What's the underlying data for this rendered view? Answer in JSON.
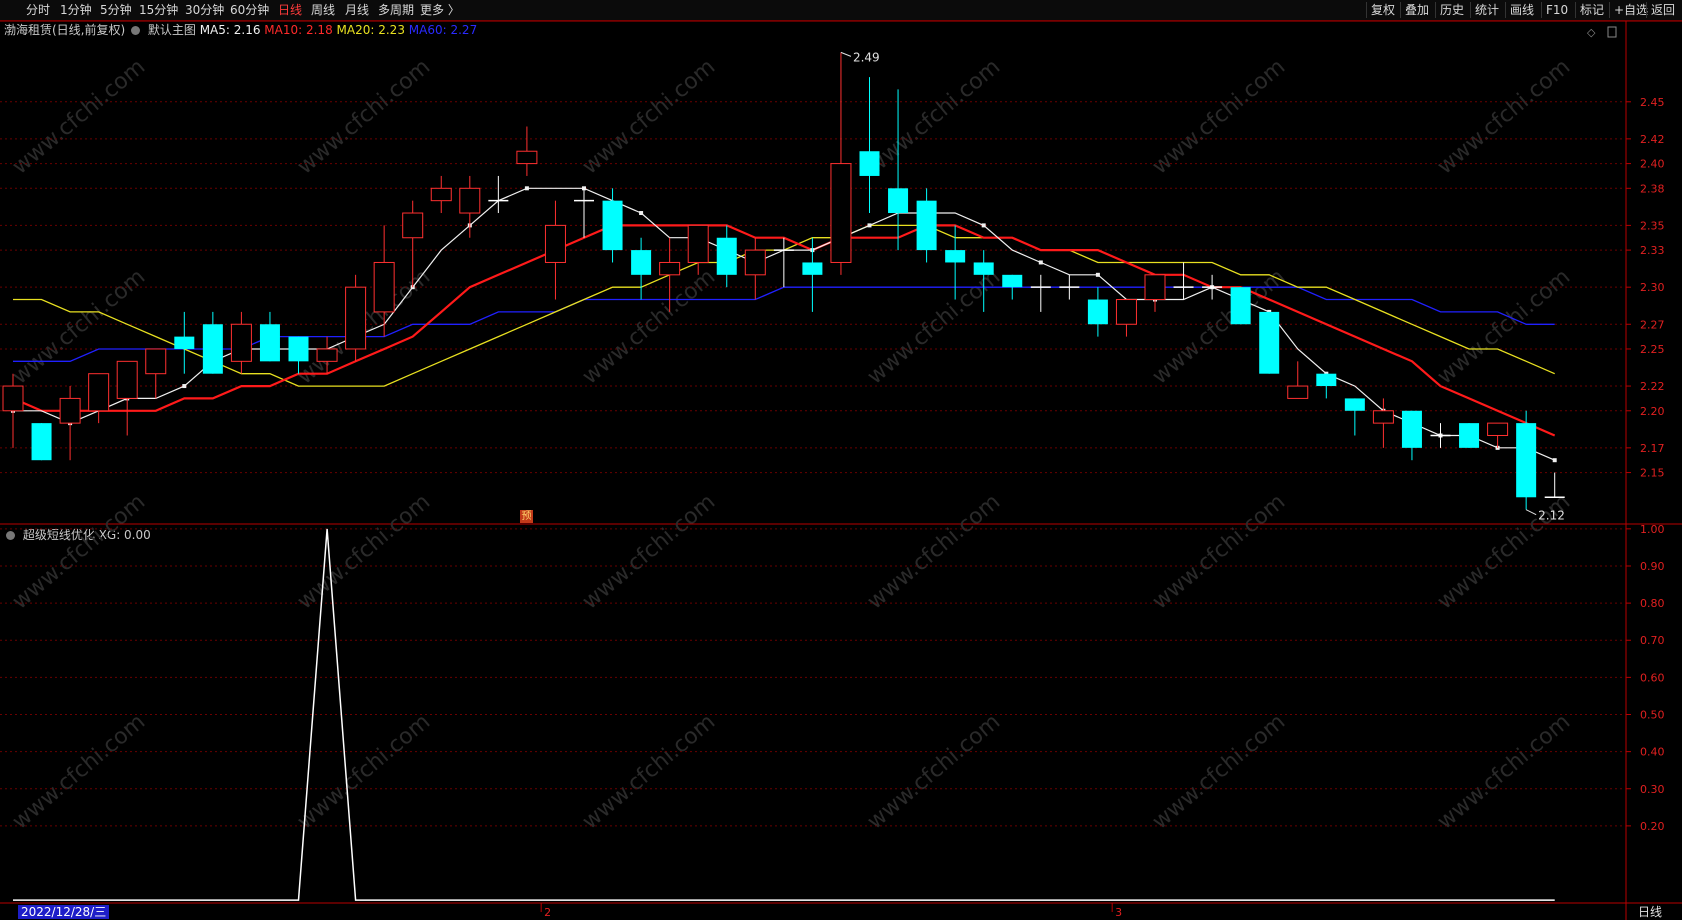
{
  "toolbar": {
    "left_items": [
      "分时",
      "1分钟",
      "5分钟",
      "15分钟",
      "30分钟",
      "60分钟",
      "日线",
      "周线",
      "月线",
      "多周期",
      "更多 〉"
    ],
    "active": "日线",
    "right_items": [
      "复权",
      "叠加",
      "历史",
      "统计",
      "画线",
      "F10",
      "标记",
      "+自选",
      "返回"
    ]
  },
  "main_panel": {
    "title": "渤海租赁(日线,前复权)",
    "template": "默认主图",
    "ma5_label": "MA5: 2.16",
    "ma10_label": "MA10: 2.18",
    "ma20_label": "MA20: 2.23",
    "ma60_label": "MA60: 2.27",
    "high_marker": "2.49",
    "low_marker": "2.12",
    "pre_badge": "预"
  },
  "indicator_panel": {
    "title": "超级短线优化",
    "value_label": "XG: 0.00"
  },
  "bottom": {
    "date_label": "2022/12/28/三",
    "month_markers": [
      "2",
      "3"
    ],
    "period_button": "日线"
  },
  "watermark": "www.cfchi.com",
  "colors": {
    "up": "#ff3030",
    "down": "#00ffff",
    "ma5": "#f0f0f0",
    "ma10": "#ff1a1a",
    "ma20": "#e8e020",
    "ma60": "#2020ff",
    "axis": "#b80000",
    "grid": "#6a0000",
    "indicator": "#ffffff"
  },
  "chart_data": [
    {
      "type": "candlestick",
      "y_ticks": [
        2.15,
        2.17,
        2.2,
        2.22,
        2.25,
        2.27,
        2.3,
        2.33,
        2.35,
        2.38,
        2.4,
        2.42,
        2.45
      ],
      "ylim": [
        2.11,
        2.5
      ],
      "candles": [
        {
          "o": 2.2,
          "c": 2.22,
          "h": 2.23,
          "l": 2.17
        },
        {
          "o": 2.19,
          "c": 2.16,
          "h": 2.19,
          "l": 2.16
        },
        {
          "o": 2.19,
          "c": 2.21,
          "h": 2.22,
          "l": 2.16
        },
        {
          "o": 2.2,
          "c": 2.23,
          "h": 2.23,
          "l": 2.19
        },
        {
          "o": 2.21,
          "c": 2.24,
          "h": 2.24,
          "l": 2.18
        },
        {
          "o": 2.23,
          "c": 2.25,
          "h": 2.25,
          "l": 2.21
        },
        {
          "o": 2.26,
          "c": 2.25,
          "h": 2.28,
          "l": 2.23
        },
        {
          "o": 2.27,
          "c": 2.23,
          "h": 2.28,
          "l": 2.23
        },
        {
          "o": 2.24,
          "c": 2.27,
          "h": 2.28,
          "l": 2.23
        },
        {
          "o": 2.27,
          "c": 2.24,
          "h": 2.28,
          "l": 2.24
        },
        {
          "o": 2.26,
          "c": 2.24,
          "h": 2.26,
          "l": 2.23
        },
        {
          "o": 2.24,
          "c": 2.25,
          "h": 2.26,
          "l": 2.23
        },
        {
          "o": 2.25,
          "c": 2.3,
          "h": 2.31,
          "l": 2.24
        },
        {
          "o": 2.28,
          "c": 2.32,
          "h": 2.35,
          "l": 2.26
        },
        {
          "o": 2.34,
          "c": 2.36,
          "h": 2.37,
          "l": 2.3
        },
        {
          "o": 2.37,
          "c": 2.38,
          "h": 2.39,
          "l": 2.36
        },
        {
          "o": 2.36,
          "c": 2.38,
          "h": 2.39,
          "l": 2.34
        },
        {
          "o": 2.37,
          "c": 2.37,
          "h": 2.39,
          "l": 2.36
        },
        {
          "o": 2.4,
          "c": 2.41,
          "h": 2.43,
          "l": 2.39
        },
        {
          "o": 2.32,
          "c": 2.35,
          "h": 2.37,
          "l": 2.29
        },
        {
          "o": 2.37,
          "c": 2.37,
          "h": 2.38,
          "l": 2.34
        },
        {
          "o": 2.37,
          "c": 2.33,
          "h": 2.38,
          "l": 2.32
        },
        {
          "o": 2.33,
          "c": 2.31,
          "h": 2.34,
          "l": 2.29
        },
        {
          "o": 2.31,
          "c": 2.32,
          "h": 2.34,
          "l": 2.28
        },
        {
          "o": 2.32,
          "c": 2.35,
          "h": 2.35,
          "l": 2.31
        },
        {
          "o": 2.34,
          "c": 2.31,
          "h": 2.35,
          "l": 2.3
        },
        {
          "o": 2.31,
          "c": 2.33,
          "h": 2.34,
          "l": 2.29
        },
        {
          "o": 2.33,
          "c": 2.33,
          "h": 2.34,
          "l": 2.3
        },
        {
          "o": 2.32,
          "c": 2.31,
          "h": 2.34,
          "l": 2.28
        },
        {
          "o": 2.32,
          "c": 2.4,
          "h": 2.49,
          "l": 2.31
        },
        {
          "o": 2.41,
          "c": 2.39,
          "h": 2.47,
          "l": 2.36
        },
        {
          "o": 2.38,
          "c": 2.36,
          "h": 2.46,
          "l": 2.33
        },
        {
          "o": 2.37,
          "c": 2.33,
          "h": 2.38,
          "l": 2.32
        },
        {
          "o": 2.33,
          "c": 2.32,
          "h": 2.35,
          "l": 2.29
        },
        {
          "o": 2.32,
          "c": 2.31,
          "h": 2.33,
          "l": 2.28
        },
        {
          "o": 2.31,
          "c": 2.3,
          "h": 2.31,
          "l": 2.29
        },
        {
          "o": 2.3,
          "c": 2.3,
          "h": 2.31,
          "l": 2.28
        },
        {
          "o": 2.3,
          "c": 2.3,
          "h": 2.31,
          "l": 2.29
        },
        {
          "o": 2.29,
          "c": 2.27,
          "h": 2.3,
          "l": 2.26
        },
        {
          "o": 2.27,
          "c": 2.29,
          "h": 2.29,
          "l": 2.26
        },
        {
          "o": 2.29,
          "c": 2.31,
          "h": 2.31,
          "l": 2.28
        },
        {
          "o": 2.3,
          "c": 2.3,
          "h": 2.32,
          "l": 2.29
        },
        {
          "o": 2.3,
          "c": 2.3,
          "h": 2.31,
          "l": 2.29
        },
        {
          "o": 2.3,
          "c": 2.27,
          "h": 2.3,
          "l": 2.27
        },
        {
          "o": 2.28,
          "c": 2.23,
          "h": 2.28,
          "l": 2.23
        },
        {
          "o": 2.21,
          "c": 2.22,
          "h": 2.24,
          "l": 2.21
        },
        {
          "o": 2.23,
          "c": 2.22,
          "h": 2.23,
          "l": 2.21
        },
        {
          "o": 2.21,
          "c": 2.2,
          "h": 2.21,
          "l": 2.18
        },
        {
          "o": 2.19,
          "c": 2.2,
          "h": 2.21,
          "l": 2.17
        },
        {
          "o": 2.2,
          "c": 2.17,
          "h": 2.2,
          "l": 2.16
        },
        {
          "o": 2.18,
          "c": 2.18,
          "h": 2.19,
          "l": 2.17
        },
        {
          "o": 2.19,
          "c": 2.17,
          "h": 2.19,
          "l": 2.17
        },
        {
          "o": 2.18,
          "c": 2.19,
          "h": 2.19,
          "l": 2.17
        },
        {
          "o": 2.19,
          "c": 2.13,
          "h": 2.2,
          "l": 2.12
        },
        {
          "o": 2.13,
          "c": 2.13,
          "h": 2.15,
          "l": 2.13
        }
      ],
      "ma5": [
        2.2,
        2.2,
        2.19,
        2.2,
        2.21,
        2.21,
        2.22,
        2.24,
        2.25,
        2.25,
        2.25,
        2.25,
        2.26,
        2.27,
        2.3,
        2.33,
        2.35,
        2.37,
        2.38,
        2.38,
        2.38,
        2.37,
        2.36,
        2.34,
        2.34,
        2.33,
        2.32,
        2.33,
        2.33,
        2.34,
        2.35,
        2.36,
        2.36,
        2.36,
        2.35,
        2.33,
        2.32,
        2.31,
        2.31,
        2.29,
        2.29,
        2.29,
        2.3,
        2.29,
        2.28,
        2.25,
        2.23,
        2.22,
        2.2,
        2.19,
        2.18,
        2.18,
        2.17,
        2.17,
        2.16
      ],
      "ma10": [
        2.21,
        2.2,
        2.2,
        2.2,
        2.2,
        2.2,
        2.21,
        2.21,
        2.22,
        2.22,
        2.23,
        2.23,
        2.24,
        2.25,
        2.26,
        2.28,
        2.3,
        2.31,
        2.32,
        2.33,
        2.34,
        2.35,
        2.35,
        2.35,
        2.35,
        2.35,
        2.34,
        2.34,
        2.33,
        2.34,
        2.34,
        2.34,
        2.35,
        2.35,
        2.34,
        2.34,
        2.33,
        2.33,
        2.33,
        2.32,
        2.31,
        2.31,
        2.3,
        2.3,
        2.29,
        2.28,
        2.27,
        2.26,
        2.25,
        2.24,
        2.22,
        2.21,
        2.2,
        2.19,
        2.18
      ],
      "ma20": [
        2.29,
        2.29,
        2.28,
        2.28,
        2.27,
        2.26,
        2.25,
        2.24,
        2.23,
        2.23,
        2.22,
        2.22,
        2.22,
        2.22,
        2.23,
        2.24,
        2.25,
        2.26,
        2.27,
        2.28,
        2.29,
        2.3,
        2.3,
        2.31,
        2.32,
        2.32,
        2.33,
        2.33,
        2.34,
        2.34,
        2.35,
        2.35,
        2.35,
        2.34,
        2.34,
        2.34,
        2.33,
        2.33,
        2.32,
        2.32,
        2.32,
        2.32,
        2.32,
        2.31,
        2.31,
        2.3,
        2.3,
        2.29,
        2.28,
        2.27,
        2.26,
        2.25,
        2.25,
        2.24,
        2.23
      ],
      "ma60": [
        2.24,
        2.24,
        2.24,
        2.25,
        2.25,
        2.25,
        2.25,
        2.25,
        2.25,
        2.26,
        2.26,
        2.26,
        2.26,
        2.26,
        2.27,
        2.27,
        2.27,
        2.28,
        2.28,
        2.28,
        2.29,
        2.29,
        2.29,
        2.29,
        2.29,
        2.29,
        2.29,
        2.3,
        2.3,
        2.3,
        2.3,
        2.3,
        2.3,
        2.3,
        2.3,
        2.3,
        2.3,
        2.3,
        2.3,
        2.3,
        2.3,
        2.3,
        2.3,
        2.3,
        2.3,
        2.3,
        2.29,
        2.29,
        2.29,
        2.29,
        2.28,
        2.28,
        2.28,
        2.27,
        2.27
      ]
    },
    {
      "type": "line",
      "series": [
        {
          "name": "XG",
          "values": [
            0,
            0,
            0,
            0,
            0,
            0,
            0,
            0,
            0,
            0,
            0,
            1,
            0,
            0,
            0,
            0,
            0,
            0,
            0,
            0,
            0,
            0,
            0,
            0,
            0,
            0,
            0,
            0,
            0,
            0,
            0,
            0,
            0,
            0,
            0,
            0,
            0,
            0,
            0,
            0,
            0,
            0,
            0,
            0,
            0,
            0,
            0,
            0,
            0,
            0,
            0,
            0,
            0,
            0,
            0
          ]
        }
      ],
      "y_ticks": [
        0.2,
        0.3,
        0.4,
        0.5,
        0.6,
        0.7,
        0.8,
        0.9,
        1.0
      ],
      "ylim": [
        -0.005,
        1.005
      ]
    }
  ]
}
